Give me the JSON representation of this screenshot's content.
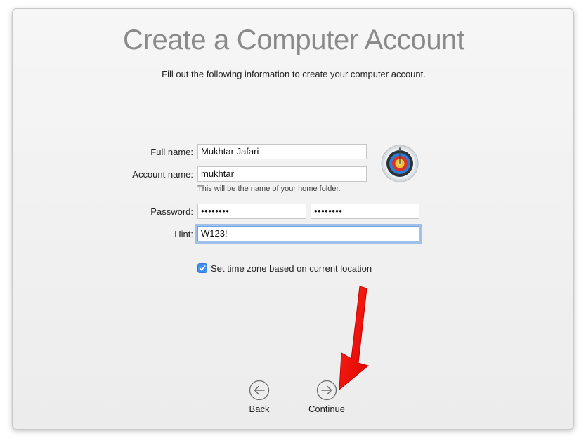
{
  "page": {
    "title": "Create a Computer Account",
    "subtitle": "Fill out the following information to create your computer account."
  },
  "form": {
    "full_name_label": "Full name:",
    "full_name_value": "Mukhtar Jafari",
    "account_name_label": "Account name:",
    "account_name_value": "mukhtar",
    "account_name_helper": "This will be the name of your home folder.",
    "password_label": "Password:",
    "password_value": "••••••••",
    "verify_value": "••••••••",
    "hint_label": "Hint:",
    "hint_value": "W123!"
  },
  "options": {
    "timezone_label": "Set time zone based on current location",
    "timezone_checked": true
  },
  "navigation": {
    "back_label": "Back",
    "continue_label": "Continue"
  },
  "colors": {
    "accent": "#3d8ef0",
    "title": "#8a8a8a",
    "annotation_arrow": "#ff0000"
  },
  "icons": {
    "avatar": "archery-target-icon",
    "back": "arrow-left-circle-icon",
    "continue": "arrow-right-circle-icon",
    "checkbox": "checkmark-icon"
  }
}
